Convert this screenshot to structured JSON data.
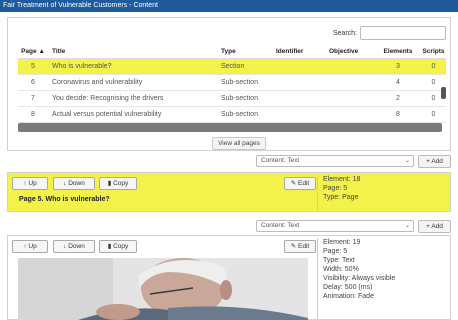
{
  "window": {
    "title": "Fair Treatment of Vulnerable Customers - Content"
  },
  "search": {
    "label": "Search:",
    "value": ""
  },
  "table": {
    "headers": {
      "page": "Page",
      "sort_icon": "▲",
      "title": "Title",
      "type": "Type",
      "identifier": "Identifier",
      "objective": "Objective",
      "elements": "Elements",
      "scripts": "Scripts"
    },
    "rows": [
      {
        "page": "5",
        "title": "Who is vulnerable?",
        "type": "Section",
        "identifier": "",
        "objective": "",
        "elements": "3",
        "scripts": "0",
        "selected": true
      },
      {
        "page": "6",
        "title": "Coronavirus and vulnerability",
        "type": "Sub-section",
        "identifier": "",
        "objective": "",
        "elements": "4",
        "scripts": "0",
        "selected": false
      },
      {
        "page": "7",
        "title": "You decide: Recognising the drivers",
        "type": "Sub-section",
        "identifier": "",
        "objective": "",
        "elements": "2",
        "scripts": "0",
        "selected": false
      },
      {
        "page": "8",
        "title": "Actual versus potential vulnerability",
        "type": "Sub-section",
        "identifier": "",
        "objective": "",
        "elements": "8",
        "scripts": "0",
        "selected": false
      }
    ]
  },
  "view_all": "View all pages",
  "selector_1": {
    "value": "Content: Text",
    "add": "+ Add"
  },
  "element_18": {
    "up": "↑ Up",
    "down": "↓ Down",
    "copy": "Copy",
    "edit": "Edit",
    "heading": "Page 5. Who is vulnerable?",
    "info": [
      "Element: 18",
      "Page: 5",
      "Type: Page"
    ]
  },
  "selector_2": {
    "value": "Content: Text",
    "add": "+ Add"
  },
  "element_19": {
    "up": "↑ Up",
    "down": "↓ Down",
    "copy": "Copy",
    "edit": "Edit",
    "info": [
      "Element: 19",
      "Page: 5",
      "Type: Text",
      "Width: 50%",
      "Visibility: Always visible",
      "Delay: 500 (ms)",
      "Animation: Fade"
    ]
  },
  "colors": {
    "titlebar": "#1f5b9c",
    "highlight": "#f2f24a"
  }
}
